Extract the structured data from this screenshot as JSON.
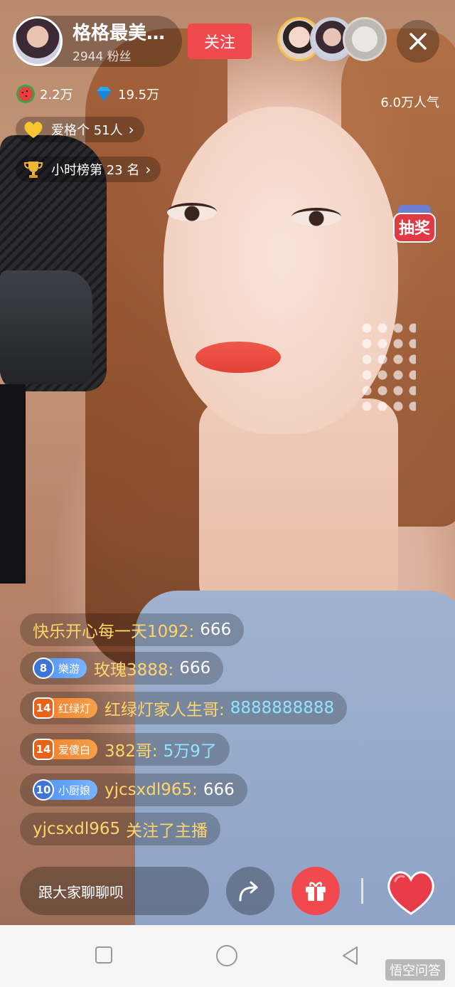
{
  "host": {
    "name": "格格最美翻...",
    "fans": "2944 粉丝",
    "follow_label": "关注"
  },
  "stats": {
    "watermelon": "2.2万",
    "diamond": "19.5万",
    "popularity": "6.0万人气"
  },
  "fan_club": "爱格个 51人",
  "hourly_rank": "小时榜第 23 名",
  "lottery_label": "抽奖",
  "chat": [
    {
      "user": "快乐开心每一天1092:",
      "message": "666",
      "badge_level": null,
      "badge_label": null,
      "badge_color": null,
      "message_color": "white"
    },
    {
      "user": "玫瑰3888:",
      "message": "666",
      "badge_level": "8",
      "badge_label": "樂游",
      "badge_color": "blue",
      "message_color": "white"
    },
    {
      "user": "红绿灯家人生哥:",
      "message": "8888888888",
      "badge_level": "14",
      "badge_label": "红绿灯",
      "badge_color": "orange",
      "message_color": "cyan"
    },
    {
      "user": "382哥:",
      "message": "5万9了",
      "badge_level": "14",
      "badge_label": "爱傻白",
      "badge_color": "orange",
      "message_color": "cyan"
    },
    {
      "user": "yjcsxdl965:",
      "message": "666",
      "badge_level": "10",
      "badge_label": "小厨娘",
      "badge_color": "blue",
      "message_color": "white"
    },
    {
      "user": "yjcsxdl965",
      "message": "关注了主播",
      "badge_level": null,
      "badge_label": null,
      "badge_color": null,
      "message_color": "user"
    }
  ],
  "input_placeholder": "跟大家聊聊呗",
  "watermark": "悟空问答",
  "colors": {
    "accent_red": "#f04a4f",
    "username_yellow": "#ffd56a",
    "message_cyan": "#8fe6ff"
  },
  "icons": [
    "close-icon",
    "watermelon-icon",
    "diamond-icon",
    "heart-icon",
    "trophy-icon",
    "share-icon",
    "gift-icon",
    "like-heart-icon",
    "nav-square-icon",
    "nav-circle-icon",
    "nav-back-icon"
  ]
}
